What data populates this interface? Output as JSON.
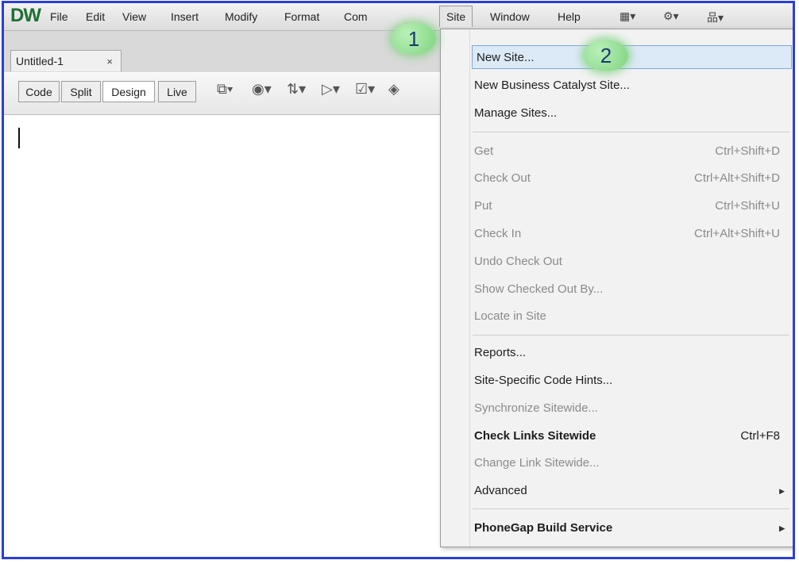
{
  "app": {
    "logo": "DW"
  },
  "menubar": {
    "items": [
      "File",
      "Edit",
      "View",
      "Insert",
      "Modify",
      "Format",
      "Com",
      "Site",
      "Window",
      "Help"
    ],
    "icons": [
      "layout-icon",
      "gear-icon",
      "sitemap-icon"
    ]
  },
  "tabs": {
    "doc_tab": "Untitled-1",
    "close_symbol": "×"
  },
  "toolbar": {
    "view_buttons": [
      "Code",
      "Split",
      "Design",
      "Live"
    ],
    "selected_view": "Design",
    "tool_icons": [
      "multiscreen-icon",
      "browser-preview-icon",
      "file-management-icon",
      "inspect-icon",
      "validate-icon",
      "visual-aids-icon"
    ]
  },
  "site_menu": {
    "items": [
      {
        "label": "New Site...",
        "shortcut": "",
        "enabled": true,
        "bold": false,
        "highlighted": true
      },
      {
        "label": "New Business Catalyst Site...",
        "shortcut": "",
        "enabled": true
      },
      {
        "label": "Manage Sites...",
        "shortcut": "",
        "enabled": true
      },
      {
        "label": "Get",
        "shortcut": "Ctrl+Shift+D",
        "enabled": false
      },
      {
        "label": "Check Out",
        "shortcut": "Ctrl+Alt+Shift+D",
        "enabled": false
      },
      {
        "label": "Put",
        "shortcut": "Ctrl+Shift+U",
        "enabled": false
      },
      {
        "label": "Check In",
        "shortcut": "Ctrl+Alt+Shift+U",
        "enabled": false
      },
      {
        "label": "Undo Check Out",
        "shortcut": "",
        "enabled": false
      },
      {
        "label": "Show Checked Out By...",
        "shortcut": "",
        "enabled": false
      },
      {
        "label": "Locate in Site",
        "shortcut": "",
        "enabled": false
      },
      {
        "label": "Reports...",
        "shortcut": "",
        "enabled": true
      },
      {
        "label": "Site-Specific Code Hints...",
        "shortcut": "",
        "enabled": true
      },
      {
        "label": "Synchronize Sitewide...",
        "shortcut": "",
        "enabled": false
      },
      {
        "label": "Check Links Sitewide",
        "shortcut": "Ctrl+F8",
        "enabled": true,
        "bold": true
      },
      {
        "label": "Change Link Sitewide...",
        "shortcut": "",
        "enabled": false
      },
      {
        "label": "Advanced",
        "shortcut": "",
        "enabled": true,
        "submenu": true
      },
      {
        "label": "PhoneGap Build Service",
        "shortcut": "",
        "enabled": true,
        "bold": true,
        "submenu": true
      }
    ]
  },
  "annotations": {
    "step1": "1",
    "step2": "2"
  },
  "colors": {
    "frame": "#2a3fd6",
    "highlight": "#dce9f7",
    "badge": "#7ed37e"
  }
}
